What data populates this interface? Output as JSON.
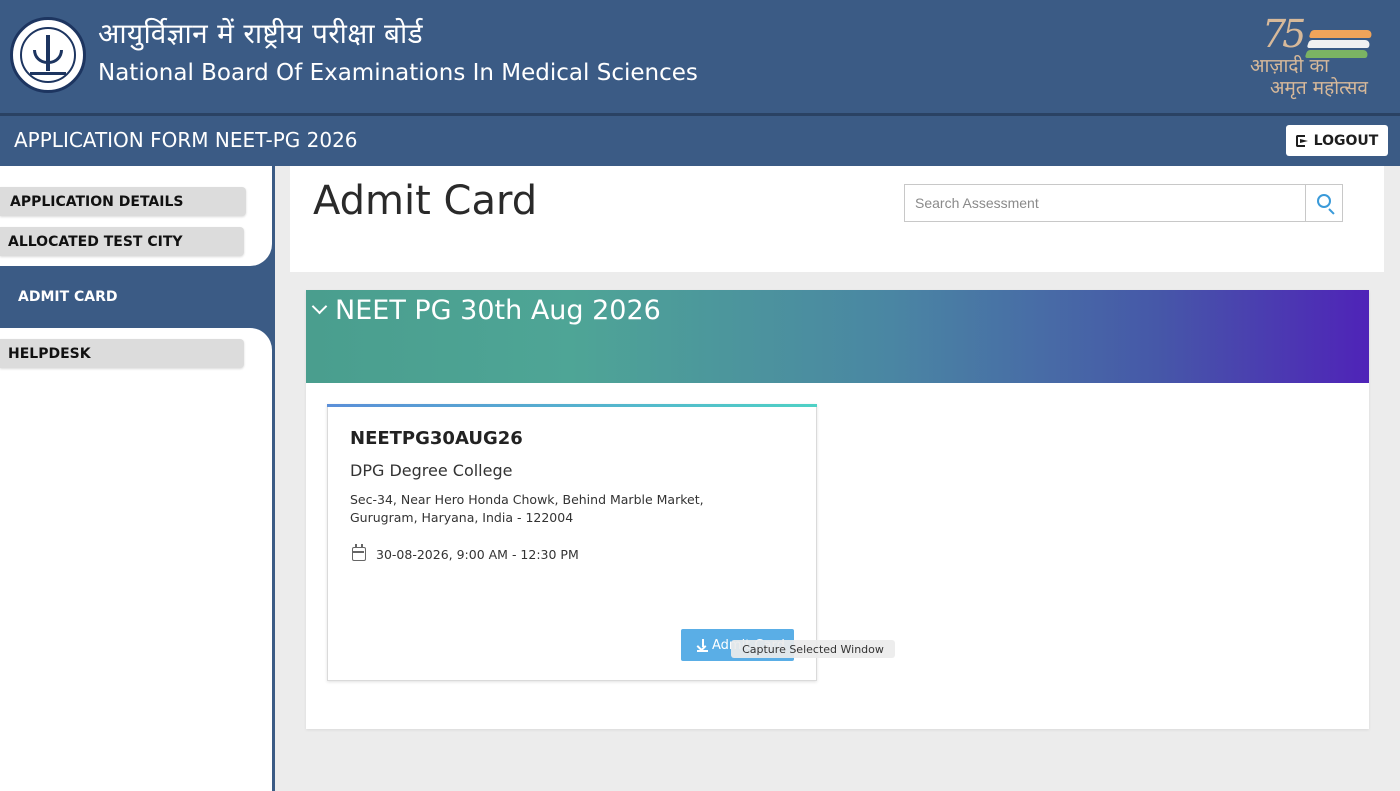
{
  "header": {
    "hindi_title": "आयुर्विज्ञान में राष्ट्रीय परीक्षा बोर्ड",
    "english_title": "National Board Of Examinations In Medical Sciences",
    "azadi_logo": {
      "number": "75",
      "line1": "आज़ादी का",
      "line2": "अमृत महोत्सव"
    }
  },
  "subheader": {
    "app_title": "APPLICATION FORM NEET-PG 2026",
    "logout_label": "LOGOUT"
  },
  "sidebar": {
    "items": [
      {
        "label": "APPLICATION DETAILS"
      },
      {
        "label": "ALLOCATED TEST CITY"
      },
      {
        "label": "ADMIT CARD",
        "active": true
      },
      {
        "label": "HELPDESK"
      }
    ]
  },
  "main": {
    "page_title": "Admit Card",
    "search": {
      "placeholder": "Search Assessment",
      "value": ""
    },
    "section_title": "NEET PG 30th Aug 2026",
    "card": {
      "code": "NEETPG30AUG26",
      "venue": "DPG Degree College",
      "address_line1": "Sec-34, Near Hero Honda Chowk, Behind Marble Market,",
      "address_line2": "Gurugram, Haryana, India - 122004",
      "datetime": "30-08-2026, 9:00 AM - 12:30 PM",
      "button_label": "Admit Card"
    },
    "tooltip": "Capture Selected Window"
  },
  "colors": {
    "header_bg": "#3b5b85",
    "accent_blue": "#5aaee6",
    "gradient_start": "#4a9e8e",
    "gradient_end": "#4f23b8"
  },
  "icons": [
    "logout-icon",
    "search-icon",
    "chevron-down-icon",
    "calendar-icon",
    "download-icon"
  ]
}
